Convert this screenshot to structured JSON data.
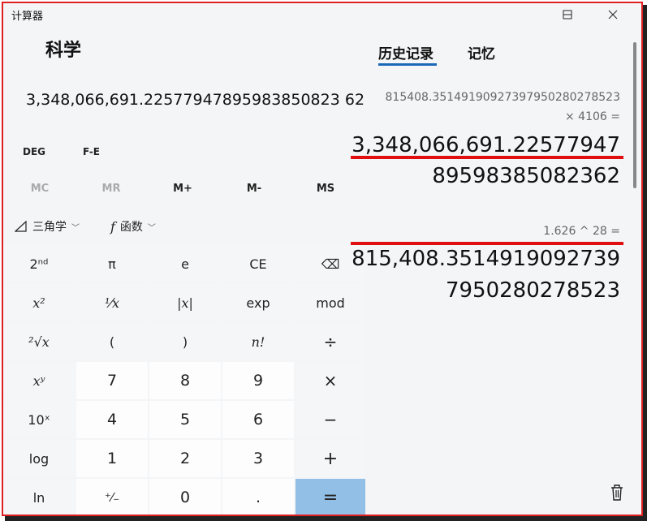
{
  "window": {
    "title": "计算器",
    "minimize_icon": "minimize-icon",
    "maximize_icon": "maximize-icon",
    "close_icon": "close-icon"
  },
  "mode": "科学",
  "display": {
    "value": "3,348,066,691.22577947895983850823 62"
  },
  "toggles": {
    "angle": "DEG",
    "fe": "F-E"
  },
  "memory": [
    "MC",
    "MR",
    "M+",
    "M-",
    "MS"
  ],
  "functions": {
    "trig": "三角学",
    "func": "函数"
  },
  "keys": [
    [
      "2ⁿᵈ",
      "π",
      "e",
      "CE",
      "⌫"
    ],
    [
      "x²",
      "¹⁄x",
      "|x|",
      "exp",
      "mod"
    ],
    [
      "²√x",
      "(",
      ")",
      "n!",
      "÷"
    ],
    [
      "xʸ",
      "7",
      "8",
      "9",
      "×"
    ],
    [
      "10ˣ",
      "4",
      "5",
      "6",
      "−"
    ],
    [
      "log",
      "1",
      "2",
      "3",
      "+"
    ],
    [
      "ln",
      "⁺⁄₋",
      "0",
      ".",
      "="
    ]
  ],
  "tabs": {
    "history": "历史记录",
    "memory": "记忆"
  },
  "history": [
    {
      "expr1": "815408.35149190927397950280278523",
      "expr2": "×  4106 =",
      "result1": "3,348,066,691.22577947",
      "result2": "89598385082362"
    },
    {
      "expr1": "1.626  ^  28 =",
      "result1": "815,408.3514919092739",
      "result2": "7950280278523"
    }
  ],
  "accent_color": "#1a68b8",
  "annotation_color": "#e01010"
}
